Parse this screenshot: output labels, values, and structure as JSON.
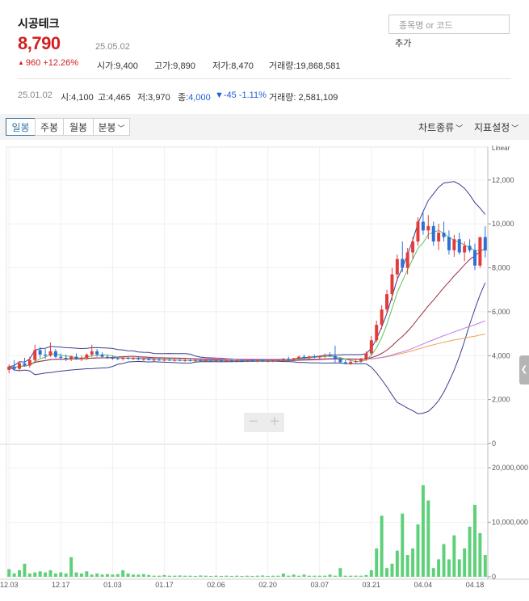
{
  "stock": {
    "name": "시공테크",
    "price": "8,790",
    "date": "25.05.02",
    "change": "960 +12.26%",
    "change_arrow": "▲",
    "open": "시가:9,400",
    "high": "고가:9,890",
    "low": "저가:8,470",
    "volume": "거래량:19,868,581"
  },
  "search": {
    "placeholder": "종목명 or 코드",
    "add_label": "추가"
  },
  "summary": {
    "date": "25.01.02",
    "open": "시:4,100",
    "high": "고:4,465",
    "low": "저:3,970",
    "close_label": "종:",
    "close_value": "4,000",
    "change": "▼-45 -1.11%",
    "volume": "거래량: 2,581,109"
  },
  "toolbar": {
    "periods": [
      "일봉",
      "주봉",
      "월봉",
      "분봉"
    ],
    "chart_type": "차트종류",
    "indicator": "지표설정"
  },
  "zoom": {
    "minus": "−",
    "plus": "+"
  },
  "colors": {
    "up": "#e33b3b",
    "down": "#2e6fd8",
    "ma5": "#5bc45b",
    "ma20": "#9b2c3c",
    "ma60": "#c07de8",
    "ma120": "#f0a050",
    "band": "#3b3f8f",
    "volume": "#5fd07a"
  },
  "chart_data": {
    "type": "candlestick",
    "scale": "Linear",
    "x_ticks": [
      "12.03",
      "12.17",
      "01.03",
      "01.17",
      "02.06",
      "02.20",
      "03.07",
      "03.21",
      "04.04",
      "04.18"
    ],
    "y_ticks": [
      "0",
      "2,000",
      "4,000",
      "6,000",
      "8,000",
      "10,000",
      "12,000"
    ],
    "y_range": [
      0,
      13500
    ],
    "volume_ticks": [
      "0",
      "10,000,000",
      "20,000,000"
    ],
    "volume_range": [
      0,
      24000000
    ],
    "candles": [
      [
        3350,
        3600,
        3200,
        3500
      ],
      [
        3500,
        3800,
        3300,
        3400
      ],
      [
        3400,
        3750,
        3300,
        3650
      ],
      [
        3650,
        3900,
        3500,
        3550
      ],
      [
        3550,
        3950,
        3450,
        3800
      ],
      [
        3800,
        4500,
        3700,
        4250
      ],
      [
        4250,
        4400,
        3900,
        4050
      ],
      [
        4050,
        4300,
        3850,
        4000
      ],
      [
        4000,
        4600,
        3950,
        4200
      ],
      [
        4200,
        4300,
        3900,
        3950
      ],
      [
        3950,
        4100,
        3800,
        3900
      ],
      [
        3900,
        4050,
        3750,
        3850
      ],
      [
        3850,
        4000,
        3750,
        3950
      ],
      [
        3950,
        4100,
        3800,
        3850
      ],
      [
        3850,
        4000,
        3750,
        3900
      ],
      [
        3900,
        4100,
        3800,
        4050
      ],
      [
        4050,
        4500,
        3950,
        4200
      ],
      [
        4200,
        4300,
        3950,
        4050
      ],
      [
        4050,
        4150,
        3900,
        3950
      ],
      [
        3950,
        4050,
        3850,
        3900
      ],
      [
        3900,
        4000,
        3800,
        3880
      ],
      [
        3880,
        3950,
        3800,
        3850
      ],
      [
        3850,
        3950,
        3780,
        3900
      ],
      [
        3900,
        3980,
        3820,
        3860
      ],
      [
        3860,
        3940,
        3800,
        3880
      ],
      [
        3880,
        3950,
        3800,
        3830
      ],
      [
        3830,
        3900,
        3760,
        3850
      ],
      [
        3850,
        3920,
        3780,
        3800
      ],
      [
        3800,
        3880,
        3740,
        3820
      ],
      [
        3820,
        3880,
        3760,
        3790
      ],
      [
        3790,
        3860,
        3740,
        3810
      ],
      [
        3810,
        3870,
        3760,
        3780
      ],
      [
        3780,
        3850,
        3730,
        3800
      ],
      [
        3800,
        3860,
        3740,
        3770
      ],
      [
        3770,
        3840,
        3720,
        3790
      ],
      [
        3790,
        3850,
        3730,
        3760
      ],
      [
        3760,
        3830,
        3710,
        3780
      ],
      [
        3780,
        3840,
        3720,
        3750
      ],
      [
        3750,
        3820,
        3700,
        3770
      ],
      [
        3770,
        3830,
        3710,
        3760
      ],
      [
        3760,
        3820,
        3700,
        3780
      ],
      [
        3780,
        3840,
        3720,
        3760
      ],
      [
        3760,
        3820,
        3700,
        3770
      ],
      [
        3770,
        3830,
        3710,
        3750
      ],
      [
        3750,
        3820,
        3700,
        3770
      ],
      [
        3770,
        3830,
        3710,
        3760
      ],
      [
        3760,
        3820,
        3700,
        3780
      ],
      [
        3780,
        3840,
        3720,
        3760
      ],
      [
        3760,
        3820,
        3700,
        3770
      ],
      [
        3770,
        3830,
        3710,
        3750
      ],
      [
        3750,
        3820,
        3700,
        3760
      ],
      [
        3760,
        3820,
        3700,
        3780
      ],
      [
        3780,
        3850,
        3720,
        3790
      ],
      [
        3790,
        3900,
        3740,
        3850
      ],
      [
        3850,
        3950,
        3780,
        3800
      ],
      [
        3800,
        3900,
        3750,
        3880
      ],
      [
        3880,
        4000,
        3820,
        3950
      ],
      [
        3950,
        4050,
        3850,
        3900
      ],
      [
        3900,
        4000,
        3820,
        3960
      ],
      [
        3960,
        4050,
        3880,
        3920
      ],
      [
        3920,
        4000,
        3850,
        3980
      ],
      [
        3980,
        4100,
        3900,
        4030
      ],
      [
        4030,
        4150,
        3950,
        3980
      ],
      [
        3980,
        4450,
        3700,
        3850
      ],
      [
        3850,
        3900,
        3650,
        3700
      ],
      [
        3700,
        3800,
        3600,
        3650
      ],
      [
        3650,
        3800,
        3580,
        3720
      ],
      [
        3720,
        3850,
        3650,
        3750
      ],
      [
        3750,
        3900,
        3680,
        3820
      ],
      [
        3820,
        4200,
        3760,
        4100
      ],
      [
        4100,
        4900,
        4000,
        4700
      ],
      [
        4700,
        5600,
        4600,
        5400
      ],
      [
        5400,
        6300,
        5200,
        6100
      ],
      [
        6100,
        7000,
        5900,
        6800
      ],
      [
        6800,
        8000,
        6500,
        7700
      ],
      [
        7700,
        8600,
        7400,
        8400
      ],
      [
        8400,
        9200,
        7800,
        8000
      ],
      [
        8000,
        8900,
        7700,
        8700
      ],
      [
        8700,
        9400,
        8400,
        9200
      ],
      [
        9200,
        10300,
        9000,
        10100
      ],
      [
        10100,
        10600,
        9500,
        9700
      ],
      [
        9700,
        10400,
        9300,
        9900
      ],
      [
        9900,
        10100,
        9000,
        9200
      ],
      [
        9200,
        10000,
        8800,
        9600
      ],
      [
        9600,
        10100,
        9200,
        9400
      ],
      [
        9400,
        9700,
        8600,
        8800
      ],
      [
        8800,
        9500,
        8500,
        9300
      ],
      [
        9300,
        9600,
        8600,
        8700
      ],
      [
        8700,
        9200,
        8300,
        9000
      ],
      [
        9000,
        9300,
        8700,
        8800
      ],
      [
        8800,
        9100,
        7900,
        8100
      ],
      [
        8100,
        9100,
        8000,
        9400
      ],
      [
        9400,
        9890,
        8470,
        8790
      ]
    ],
    "volumes": [
      0.35,
      0.15,
      0.3,
      0.6,
      0.15,
      0.2,
      0.25,
      0.2,
      0.3,
      0.15,
      0.2,
      0.15,
      0.9,
      0.2,
      0.15,
      0.25,
      0.1,
      0.15,
      0.1,
      0.12,
      0.1,
      0.12,
      0.3,
      0.15,
      0.1,
      0.1,
      0.12,
      0.08,
      0.05,
      0.05,
      0.08,
      0.05,
      0.05,
      0.06,
      0.05,
      0.05,
      0.04,
      0.06,
      0.05,
      0.04,
      0.05,
      0.04,
      0.05,
      0.04,
      0.05,
      0.04,
      0.05,
      0.04,
      0.05,
      0.06,
      0.04,
      0.05,
      0.05,
      0.15,
      0.05,
      0.1,
      0.05,
      0.1,
      0.05,
      0.05,
      0.05,
      0.05,
      0.1,
      0.05,
      0.4,
      0.05,
      0.05,
      0.05,
      0.05,
      0.08,
      0.3,
      1.3,
      2.8,
      0.4,
      0.6,
      1.2,
      2.9,
      1.0,
      1.3,
      2.4,
      4.2,
      3.5,
      0.4,
      0.8,
      1.5,
      0.8,
      1.9,
      0.8,
      1.3,
      2.3,
      3.3,
      2.0,
      1.0
    ]
  }
}
